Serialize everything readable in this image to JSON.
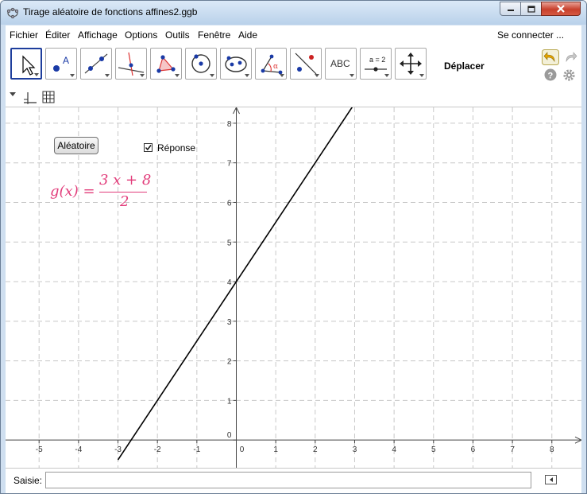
{
  "window": {
    "title": "Tirage aléatoire de fonctions affines2.ggb",
    "minimize_icon": "minimize-icon",
    "maximize_icon": "maximize-icon",
    "close_icon": "close-icon"
  },
  "menu": {
    "items": [
      "Fichier",
      "Éditer",
      "Affichage",
      "Options",
      "Outils",
      "Fenêtre",
      "Aide"
    ],
    "signin": "Se connecter ..."
  },
  "toolbar": {
    "tools": [
      {
        "name": "move",
        "icon": "cursor-arrow-icon",
        "selected": true
      },
      {
        "name": "point",
        "icon": "point-icon",
        "label": "A"
      },
      {
        "name": "line",
        "icon": "line-through-points-icon"
      },
      {
        "name": "perpendicular",
        "icon": "perpendicular-line-icon"
      },
      {
        "name": "polygon",
        "icon": "polygon-icon"
      },
      {
        "name": "circle",
        "icon": "circle-center-point-icon"
      },
      {
        "name": "conic",
        "icon": "ellipse-icon"
      },
      {
        "name": "angle",
        "icon": "angle-icon",
        "label": "α"
      },
      {
        "name": "reflect",
        "icon": "reflect-about-line-icon"
      },
      {
        "name": "text",
        "icon": "text-icon",
        "label": "ABC"
      },
      {
        "name": "slider",
        "icon": "slider-icon",
        "label": "a = 2"
      },
      {
        "name": "move-view",
        "icon": "move-graphics-view-icon"
      }
    ],
    "tool_title": "Déplacer",
    "undo_icon": "undo-icon",
    "redo_icon": "redo-icon",
    "help_icon": "help-icon",
    "settings_icon": "gear-icon"
  },
  "stylebar": {
    "toggle_icon": "triangle-toggle-icon",
    "axes_icon": "axes-icon",
    "grid_icon": "grid-icon"
  },
  "graphics": {
    "random_button": "Aléatoire",
    "checkbox_label": "Réponse",
    "checkbox_checked": true,
    "formula": {
      "lhs": "g(x) =",
      "numerator": "3 x + 8",
      "denominator": "2"
    },
    "line_color": "#000000",
    "formula_color": "#e23d7b"
  },
  "chart_data": {
    "type": "line",
    "title": "",
    "xlabel": "",
    "ylabel": "",
    "xlim": [
      -5.85,
      8.75
    ],
    "ylim": [
      -0.7,
      8.4
    ],
    "grid": true,
    "x_ticks": [
      -5,
      -4,
      -3,
      -2,
      -1,
      0,
      1,
      2,
      3,
      4,
      5,
      6,
      7,
      8
    ],
    "y_ticks": [
      0,
      1,
      2,
      3,
      4,
      5,
      6,
      7,
      8
    ],
    "series": [
      {
        "function": "g(x) = (3x + 8)/2",
        "slope": 1.5,
        "intercept": 4,
        "x": [
          -3,
          3
        ],
        "y": [
          -0.5,
          8.5
        ]
      }
    ]
  },
  "input": {
    "label": "Saisie:",
    "value": "",
    "help_icon": "input-help-icon"
  }
}
